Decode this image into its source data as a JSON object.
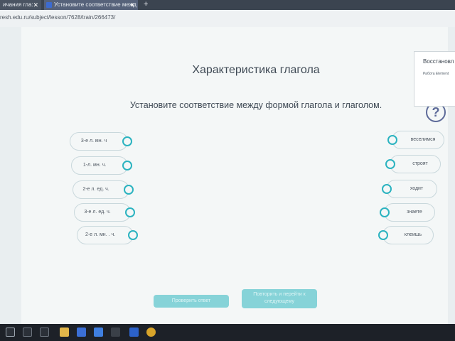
{
  "browser": {
    "tabs": [
      {
        "label": "ичания гла:",
        "close": "✕"
      },
      {
        "label": "Установите соответствие межд",
        "close": "✕"
      }
    ],
    "new_tab": "+",
    "url": "resh.edu.ru/subject/lesson/7628/train/266473/"
  },
  "notification": {
    "title": "Восстановл",
    "subtitle": "Работа Element"
  },
  "main": {
    "title": "Характеристика глагола",
    "instruction": "Установите соответствие между формой глагола и глаголом.",
    "help_label": "?"
  },
  "left_items": [
    "3-е л. мн. ч",
    "1-л. мн. ч.",
    "2-е л. ед. ч.",
    "3-е л. ед. ч.",
    "2-е л. мн. . ч."
  ],
  "right_items": [
    "веселимся",
    "строят",
    "ходит",
    "знаете",
    "клеишь"
  ],
  "buttons": {
    "check": "Проверить ответ",
    "reset": "Повторить и перейти к следующему"
  },
  "colors": {
    "accent": "#2bb3c0",
    "button": "#86d3d8",
    "help": "#5d6a99"
  },
  "taskbar": {
    "icons": [
      "windows-icon",
      "search-icon",
      "task-view-icon",
      "file-explorer-icon",
      "store-icon",
      "mail-icon",
      "chrome-icon"
    ]
  }
}
